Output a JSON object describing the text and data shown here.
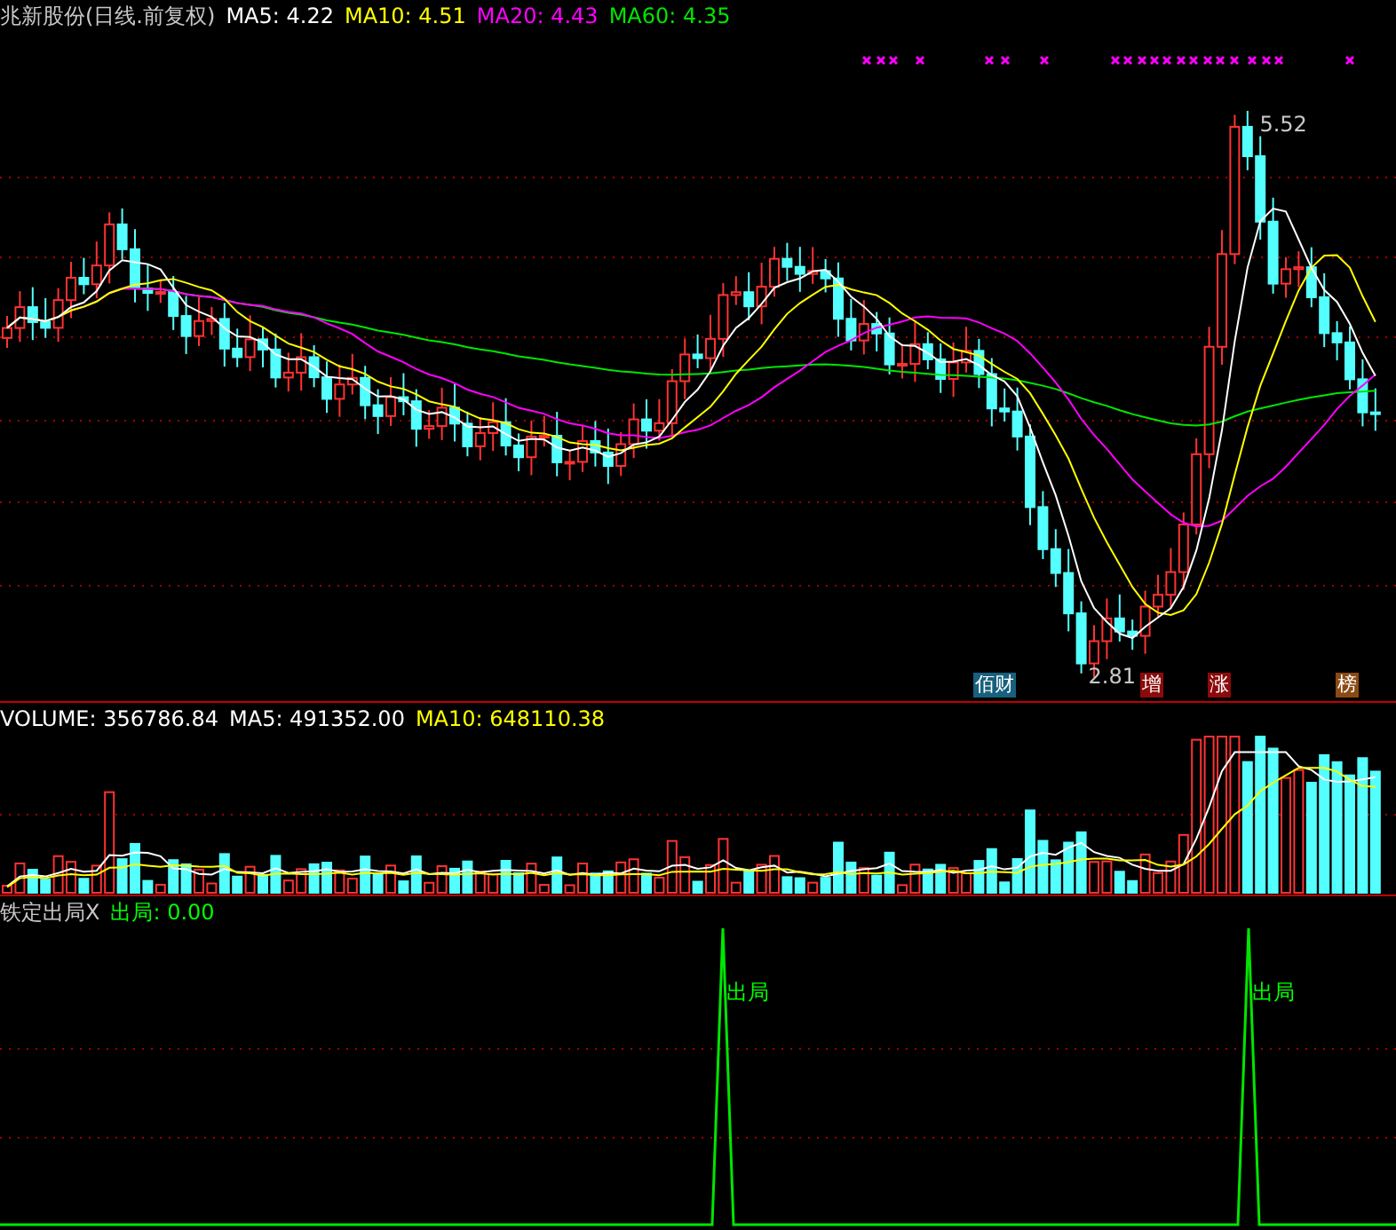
{
  "main": {
    "title": "兆新股份(日线.前复权)",
    "indicators": [
      {
        "label": "MA5: 4.22",
        "color": "#ffffff"
      },
      {
        "label": "MA10: 4.51",
        "color": "#ffff00"
      },
      {
        "label": "MA20: 4.43",
        "color": "#ff00ff"
      },
      {
        "label": "MA60: 4.35",
        "color": "#00e600"
      }
    ],
    "high_label": "5.52",
    "low_label": "2.81",
    "badges": [
      {
        "text": "佰财",
        "color": "#17607e"
      },
      {
        "text": "增",
        "color": "#8b0a0a"
      },
      {
        "text": "涨",
        "color": "#8b0a0a"
      },
      {
        "text": "榜",
        "color": "#8a4a12"
      }
    ]
  },
  "volume": {
    "indicators": [
      {
        "label": "VOLUME: 356786.84",
        "color": "#ffffff"
      },
      {
        "label": "MA5: 491352.00",
        "color": "#ffffff"
      },
      {
        "label": "MA10: 648110.38",
        "color": "#ffff00"
      }
    ]
  },
  "signal": {
    "title": "铁定出局X",
    "indicators": [
      {
        "label": "出局: 0.00",
        "color": "#00ff00"
      }
    ],
    "markers": [
      "出局",
      "出局"
    ]
  }
}
